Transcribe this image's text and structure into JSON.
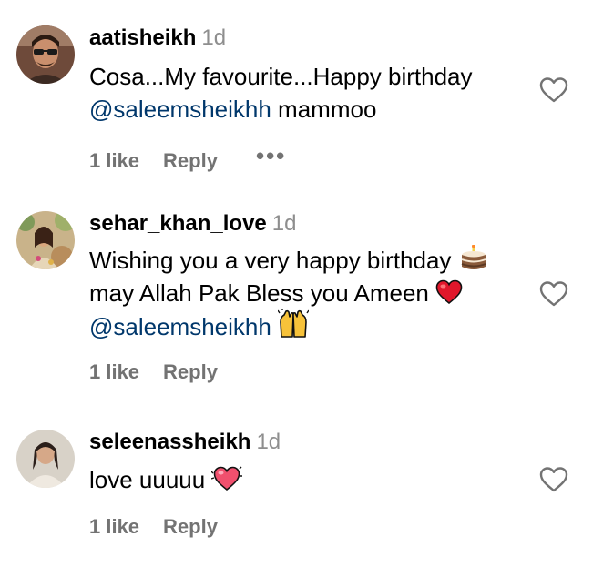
{
  "comments": [
    {
      "username": "aatisheikh",
      "time": "1d",
      "text_line1": "Cosa...My favourite...Happy birthday",
      "mention": "@saleemsheikhh",
      "text_after_mention": " mammoo",
      "likes": "1 like",
      "reply": "Reply",
      "more": "•••"
    },
    {
      "username": "sehar_khan_love",
      "time": "1d",
      "text_line1": "Wishing you a very happy birthday ",
      "text_line2": "may Allah Pak Bless you Ameen ",
      "mention": "@saleemsheikhh",
      "likes": "1 like",
      "reply": "Reply"
    },
    {
      "username": "seleenassheikh",
      "time": "1d",
      "text_line1": "love uuuuu ",
      "likes": "1 like",
      "reply": "Reply"
    }
  ],
  "icons": {
    "like": "heart-outline-icon",
    "cake": "birthday-cake-emoji",
    "red_heart": "red-heart-emoji",
    "raised_hands": "raising-hands-emoji",
    "sparkle_heart": "heart-emoji"
  },
  "colors": {
    "mention": "#00376b",
    "muted": "#8e8e8e",
    "actions": "#737373"
  }
}
